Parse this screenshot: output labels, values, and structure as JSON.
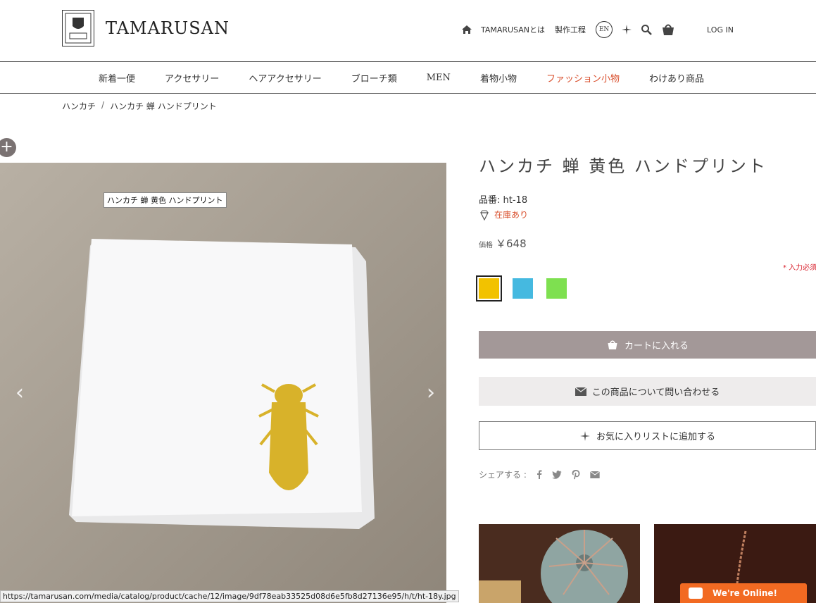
{
  "header": {
    "logo_text": "TAMARUSAN",
    "logo_emblem_text": "TAMARUSAN",
    "nav": {
      "about": "TAMARUSANとは",
      "process": "製作工程",
      "lang": "EN",
      "login": "LOG IN"
    }
  },
  "main_nav": {
    "items": [
      {
        "label": "新着一便"
      },
      {
        "label": "アクセサリー"
      },
      {
        "label": "ヘアアクセサリー"
      },
      {
        "label": "ブローチ類"
      },
      {
        "label": "MEN"
      },
      {
        "label": "着物小物"
      },
      {
        "label": "ファッション小物"
      },
      {
        "label": "わけあり商品"
      }
    ],
    "active_color": "#d9502e"
  },
  "breadcrumb": {
    "items": [
      "ハンカチ",
      "ハンカチ 蝉 ハンドプリント"
    ],
    "separator": "/"
  },
  "gallery": {
    "tooltip": "ハンカチ 蝉 黄色 ハンドプリント",
    "status_url": "https://tamarusan.com/media/catalog/product/cache/12/image/9df78eab33525d08d6e5fb8d27136e95/h/t/ht-18y.jpg"
  },
  "product": {
    "title": "ハンカチ 蝉 黄色 ハンドプリント",
    "sku_label": "品番:",
    "sku": "ht-18",
    "stock": "在庫あり",
    "price_label": "価格",
    "price": "￥648",
    "required_note": "* 入力必須",
    "swatches": [
      {
        "color": "#f2c200",
        "selected": true
      },
      {
        "color": "#45b9e0",
        "selected": false
      },
      {
        "color": "#7ee050",
        "selected": false
      }
    ],
    "add_to_cart": "カートに入れる",
    "inquiry": "この商品について問い合わせる",
    "wishlist": "お気に入りリストに追加する",
    "share_label": "シェアする :"
  },
  "chat": {
    "label": "We're Online!"
  },
  "colors": {
    "accent": "#d9502e",
    "cart_button": "#a39898",
    "chat": "#f26a22"
  }
}
